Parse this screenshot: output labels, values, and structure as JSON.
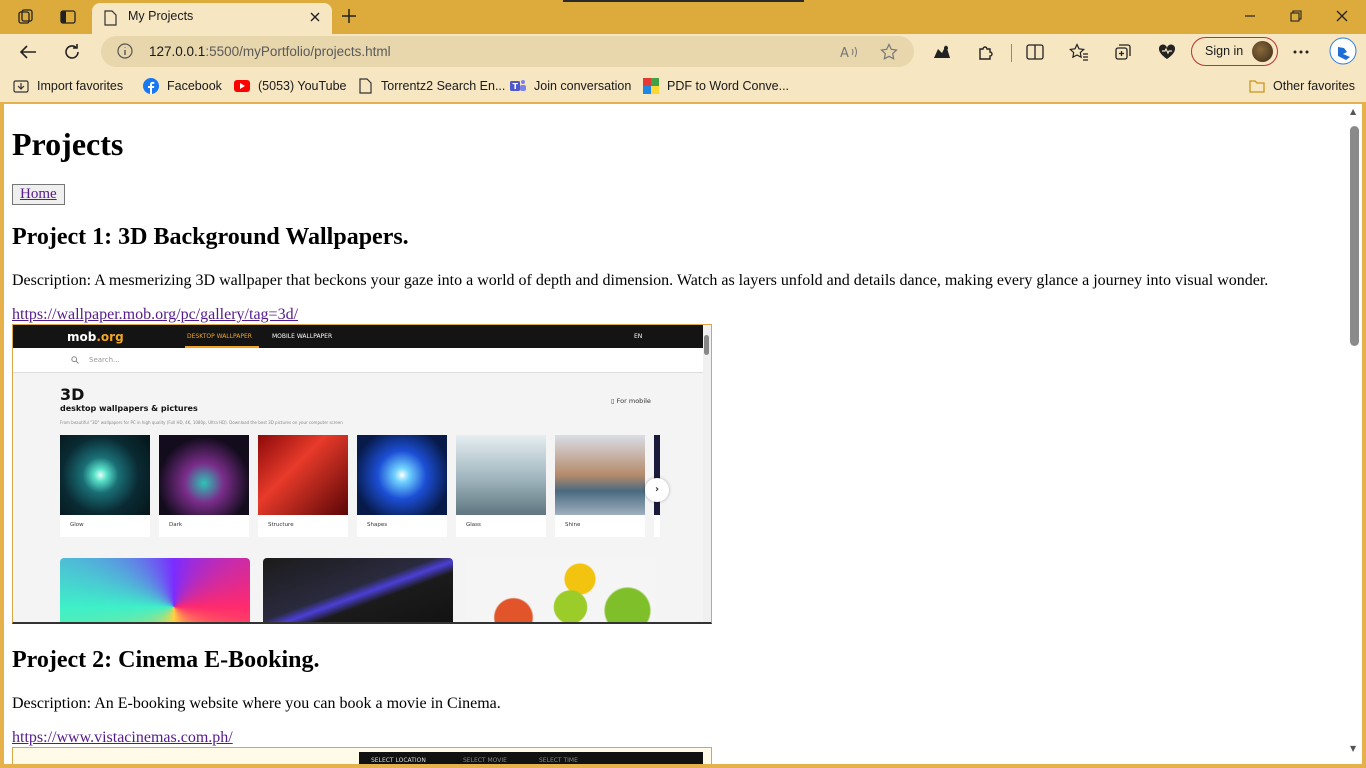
{
  "browser": {
    "tab": {
      "title": "My Projects"
    },
    "address": {
      "host": "127.0.0.1",
      "rest": ":5500/myPortfolio/projects.html"
    },
    "signin_label": "Sign in",
    "favorites": [
      {
        "label": "Import favorites",
        "icon": "import-icon"
      },
      {
        "label": "Facebook",
        "icon": "facebook-icon"
      },
      {
        "label": "(5053) YouTube",
        "icon": "youtube-icon"
      },
      {
        "label": "Torrentz2 Search En...",
        "icon": "page-icon"
      },
      {
        "label": "Join conversation",
        "icon": "teams-icon"
      },
      {
        "label": "PDF to Word Conve...",
        "icon": "pdf-icon"
      }
    ],
    "other_favorites": "Other favorites",
    "colors": {
      "frame": "#ddab3b",
      "toolbar": "#f6e6c2",
      "omnibox": "#e8d6ac",
      "signin_border": "#b73535"
    }
  },
  "page": {
    "title": "Projects",
    "home_label": "Home",
    "projects": [
      {
        "heading": "Project 1: 3D Background Wallpapers.",
        "description": "Description: A mesmerizing 3D wallpaper that beckons your gaze into a world of depth and dimension. Watch as layers unfold and details dance, making every glance a journey into visual wonder.",
        "link": "https://wallpaper.mob.org/pc/gallery/tag=3d/"
      },
      {
        "heading": "Project 2: Cinema E-Booking.",
        "description": "Description: An E-booking website where you can book a movie in Cinema.",
        "link": "https://www.vistacinemas.com.ph/"
      }
    ],
    "preview1": {
      "logo_main": "mob",
      "logo_tld": ".org",
      "nav_desktop": "DESKTOP WALLPAPER",
      "nav_mobile": "MOBILE WALLPAPER",
      "lang": "EN",
      "search_placeholder": "Search...",
      "heading": "3D",
      "subheading": "desktop wallpapers & pictures",
      "blurb": "From beautiful \"3D\" wallpapers for PC in high quality (Full HD, 4K, 1080p, Ultra HD). Download the best 3D pictures on your computer screen",
      "for_mobile": "For mobile",
      "cards": [
        "Glow",
        "Dark",
        "Structure",
        "Shapes",
        "Glass",
        "Shine"
      ]
    },
    "preview2": {
      "steps": [
        "SELECT LOCATION",
        "SELECT MOVIE",
        "SELECT TIME"
      ]
    }
  }
}
